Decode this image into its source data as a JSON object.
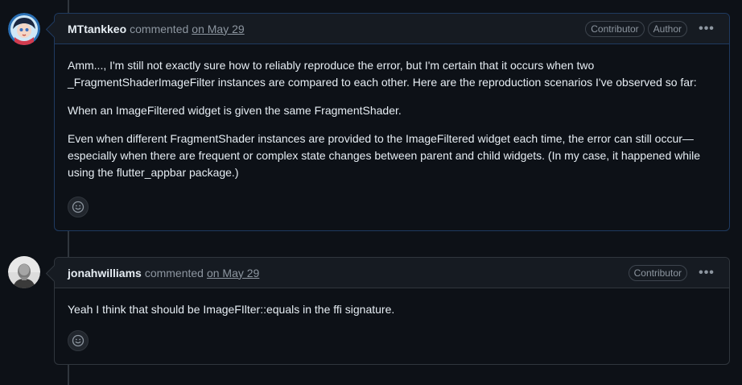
{
  "comments": [
    {
      "author": "MTtankkeo",
      "action": "commented",
      "date": "on May 29",
      "badges": [
        "Contributor",
        "Author"
      ],
      "paragraphs": [
        "Amm..., I'm still not exactly sure how to reliably reproduce the error, but I'm certain that it occurs when two _FragmentShaderImageFilter instances are compared to each other. Here are the reproduction scenarios I've observed so far:",
        "When an ImageFiltered widget is given the same FragmentShader.",
        "Even when different FragmentShader instances are provided to the ImageFiltered widget each time, the error can still occur—especially when there are frequent or complex state changes between parent and child widgets. (In my case, it happened while using the flutter_appbar package.)"
      ],
      "more_label": "•••"
    },
    {
      "author": "jonahwilliams",
      "action": "commented",
      "date": "on May 29",
      "badges": [
        "Contributor"
      ],
      "paragraphs": [
        "Yeah I think that should be ImageFIlter::equals in the ffi signature."
      ],
      "more_label": "•••"
    }
  ],
  "icons": {
    "reaction": "smiley-icon",
    "more": "kebab-horizontal-icon"
  },
  "colors": {
    "background": "#0d1117",
    "header": "#161b22",
    "border": "#30363d",
    "text": "#e6edf3",
    "muted": "#8d96a0"
  }
}
